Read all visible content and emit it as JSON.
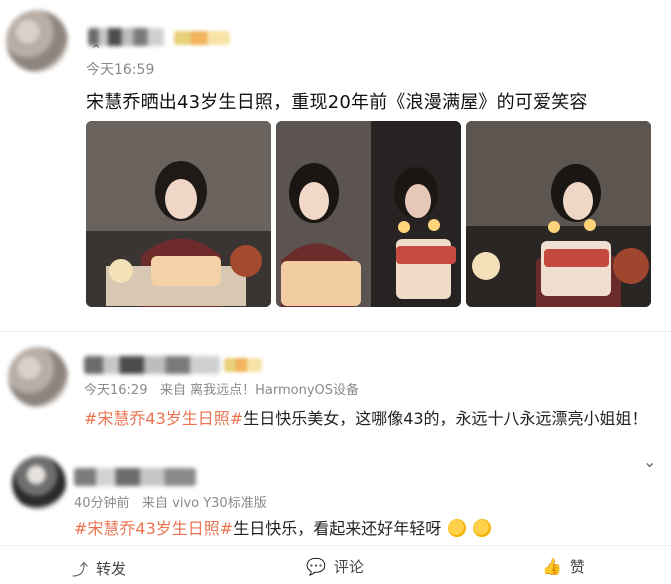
{
  "post": {
    "time": "今天16:59",
    "title": "宋慧乔晒出43岁生日照，重现20年前《浪漫满屋》的可爱笑容"
  },
  "comment1": {
    "time": "今天16:29",
    "source": "来自 离我远点！HarmonyOS设备",
    "hashtag": "#宋慧乔43岁生日照#",
    "text": "生日快乐美女，这哪像43的，永远十八永远漂亮小姐姐！"
  },
  "comment2": {
    "time": "40分钟前",
    "source": "来自 vivo Y30标准版",
    "hashtag": "#宋慧乔43岁生日照#",
    "text": "生日快乐，看起来还好年轻呀"
  },
  "footer": {
    "repost": "转发",
    "comment": "评论",
    "like": "赞"
  },
  "icons": {
    "chevron": "chevron-down-icon",
    "repost": "repost-icon",
    "comment": "comment-icon",
    "like": "thumbs-up-icon"
  }
}
